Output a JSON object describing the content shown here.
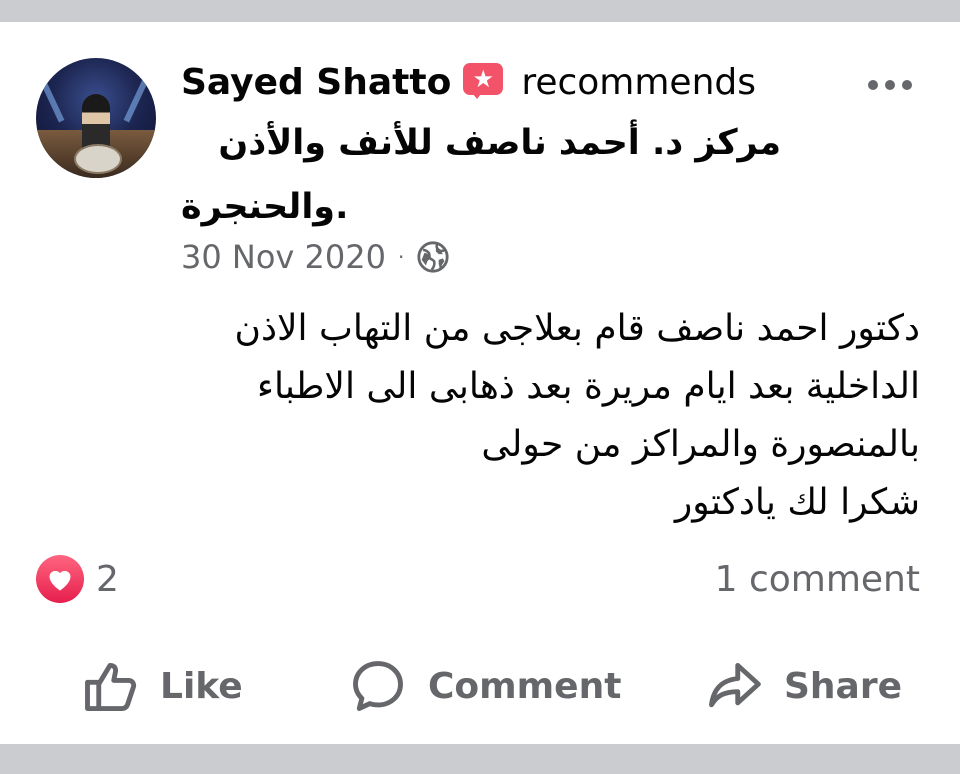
{
  "post": {
    "author": "Sayed Shatto",
    "verb": "recommends",
    "page_name_line1": "مركز د. أحمد ناصف للأنف والأذن",
    "page_name_line2": "والحنجرة.",
    "date": "30 Nov 2020",
    "separator": "·",
    "body_lines": [
      "دكتور احمد ناصف قام بعلاجى من التهاب الاذن",
      "الداخلية بعد ايام مريرة بعد ذهابى الى الاطباء",
      "بالمنصورة والمراكز من حولى",
      "شكرا لك يادكتور"
    ],
    "reaction_count": "2",
    "comments_label": "1 comment"
  },
  "actions": {
    "like": "Like",
    "comment": "Comment",
    "share": "Share"
  },
  "icons": {
    "badge": "recommendation-star-icon",
    "privacy": "globe-icon",
    "reaction": "heart-icon",
    "more": "more-options-icon"
  },
  "colors": {
    "text_primary": "#050505",
    "text_secondary": "#65676b",
    "badge": "#f35369",
    "heart": "#e61e4d",
    "divider": "#cacccf"
  }
}
